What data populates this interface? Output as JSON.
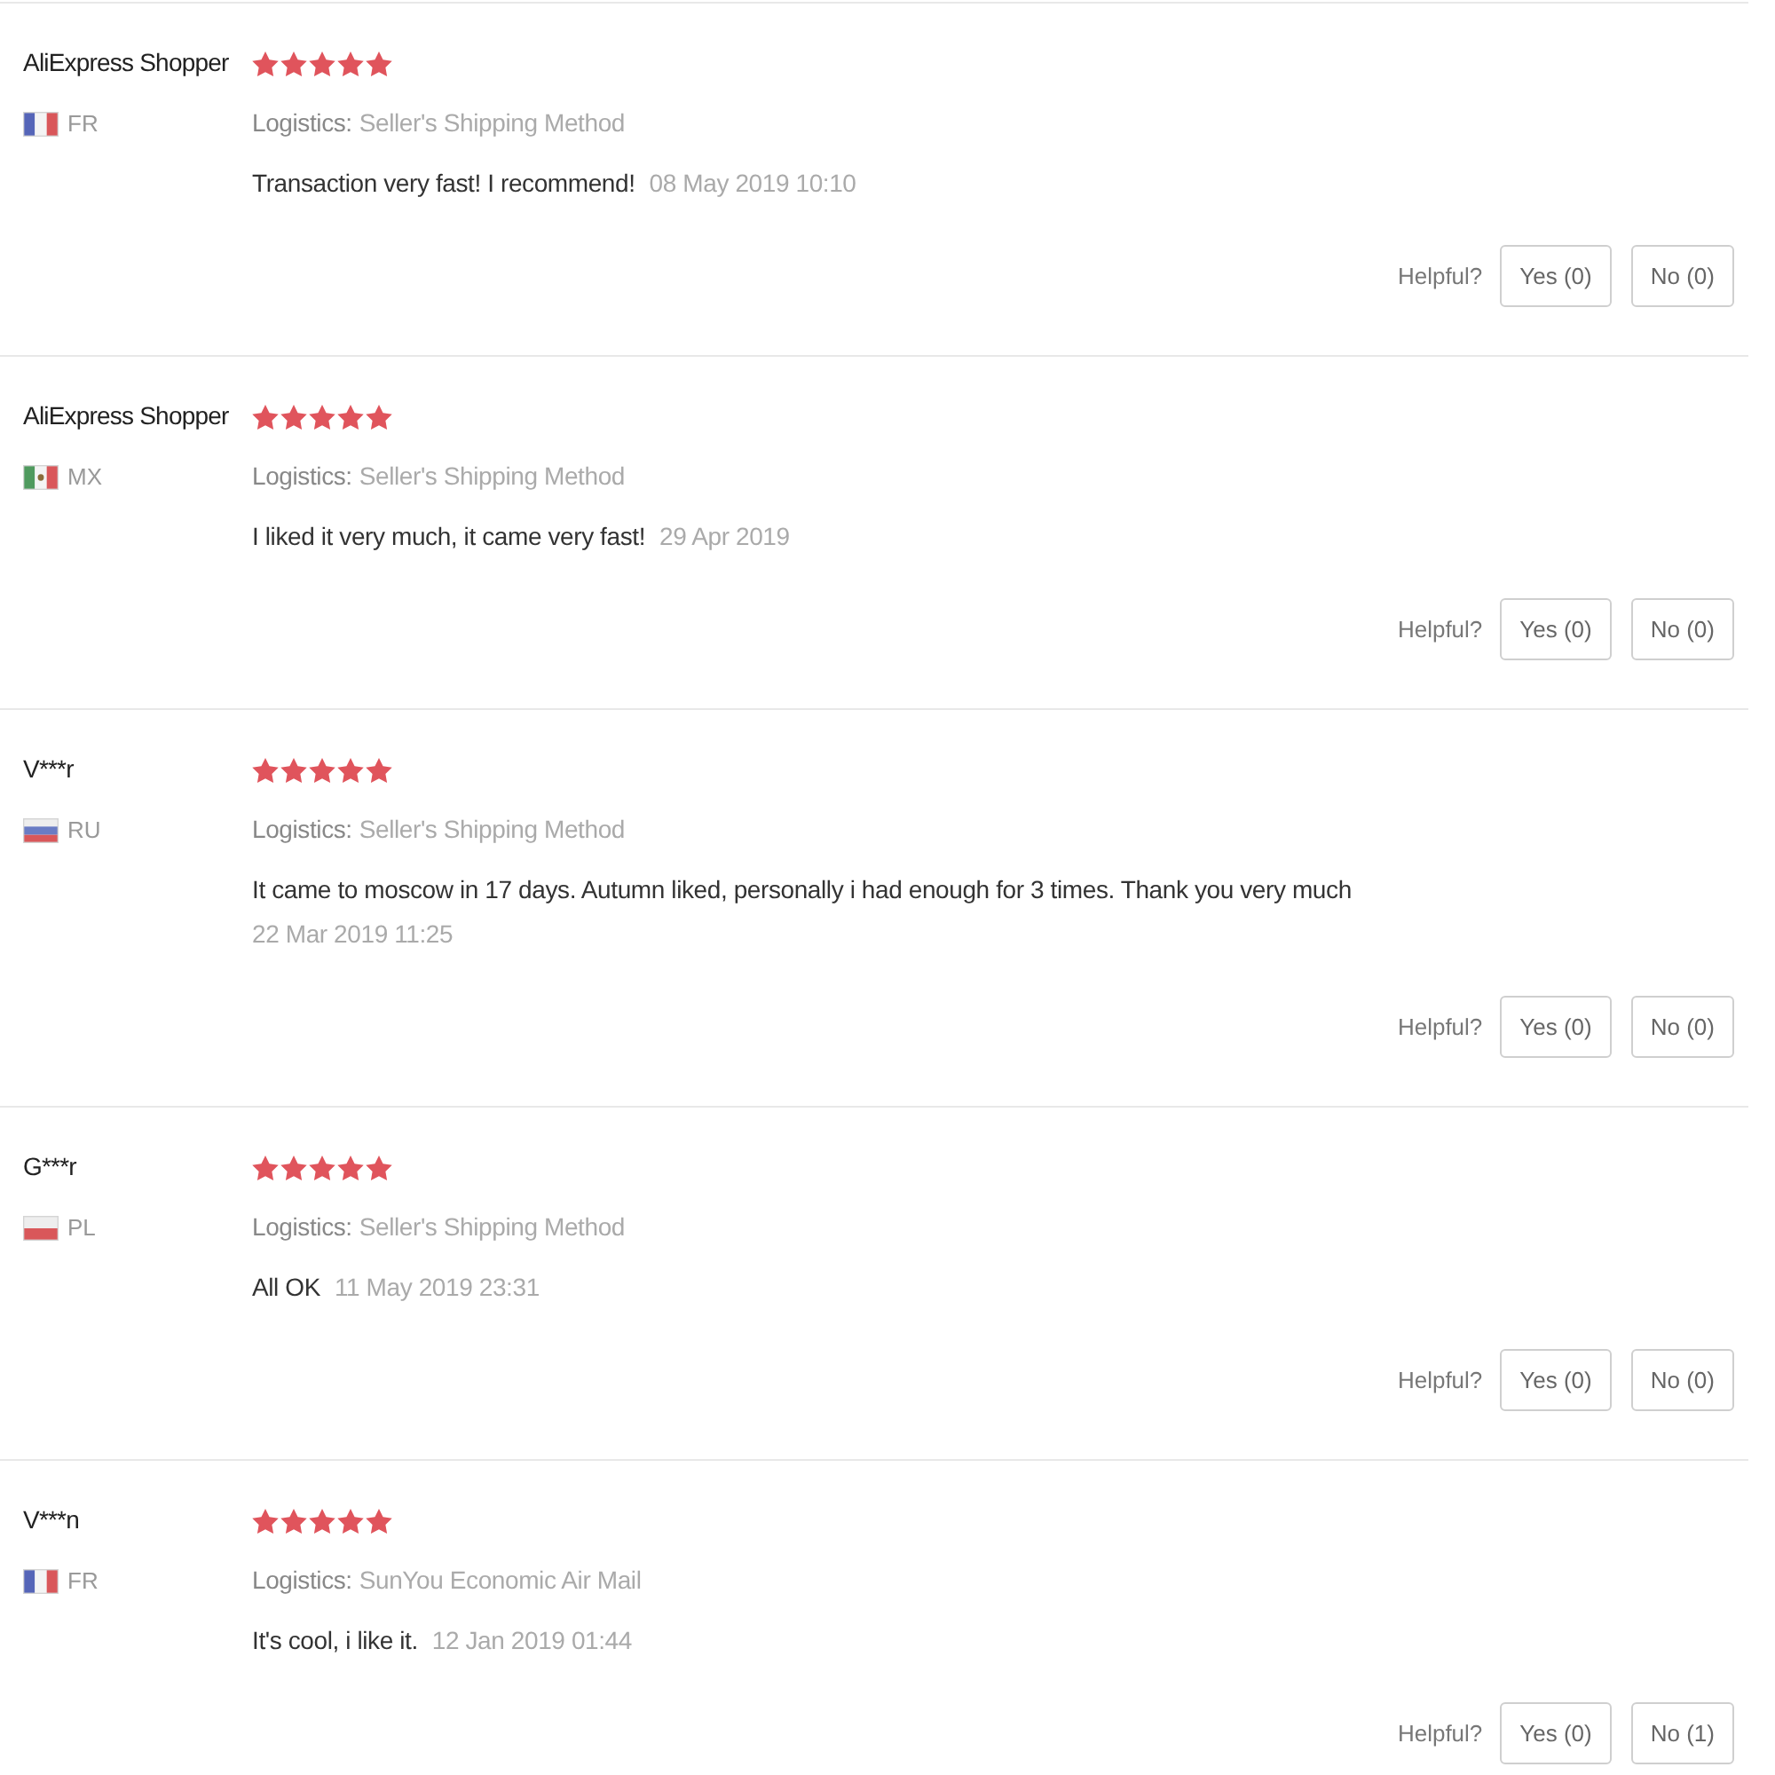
{
  "reviews": [
    {
      "name": "AliExpress Shopper",
      "stars": 5,
      "country": {
        "code": "FR",
        "flag": {
          "kind": "vertical",
          "stripes": [
            {
              "color": "#5565b8"
            },
            {
              "color": "#f4f4f4"
            },
            {
              "color": "#d9575a"
            }
          ]
        }
      },
      "logistics_label": "Logistics:",
      "logistics": "Seller's Shipping Method",
      "comment": "Transaction very fast! I recommend!",
      "date": "08 May 2019 10:10",
      "helpful_label": "Helpful?",
      "yes_button": "Yes (0)",
      "no_button": "No (0)"
    },
    {
      "name": "AliExpress Shopper",
      "stars": 5,
      "country": {
        "code": "MX",
        "flag": {
          "kind": "vertical_emblem",
          "stripes": [
            {
              "color": "#4f9a5e"
            },
            {
              "color": "#f4f4f4"
            },
            {
              "color": "#d9575a"
            }
          ]
        }
      },
      "logistics_label": "Logistics:",
      "logistics": "Seller's Shipping Method",
      "comment": "I liked it very much, it came very fast!",
      "date": "29 Apr 2019",
      "helpful_label": "Helpful?",
      "yes_button": "Yes (0)",
      "no_button": "No (0)"
    },
    {
      "name": "V***r",
      "stars": 5,
      "country": {
        "code": "RU",
        "flag": {
          "kind": "horizontal",
          "stripes": [
            {
              "color": "#eeeeee"
            },
            {
              "color": "#6a7cc4"
            },
            {
              "color": "#d9575a"
            }
          ]
        }
      },
      "logistics_label": "Logistics:",
      "logistics": "Seller's Shipping Method",
      "comment": "It came to moscow in 17 days. Autumn liked, personally i had enough for 3 times. Thank you very much",
      "date": "22 Mar 2019 11:25",
      "helpful_label": "Helpful?",
      "yes_button": "Yes (0)",
      "no_button": "No (0)"
    },
    {
      "name": "G***r",
      "stars": 5,
      "country": {
        "code": "PL",
        "flag": {
          "kind": "horizontal",
          "stripes": [
            {
              "color": "#eeeeee"
            },
            {
              "color": "#d9575a"
            }
          ]
        }
      },
      "logistics_label": "Logistics:",
      "logistics": "Seller's Shipping Method",
      "comment": "All OK",
      "date": "11 May 2019 23:31",
      "helpful_label": "Helpful?",
      "yes_button": "Yes (0)",
      "no_button": "No (0)"
    },
    {
      "name": "V***n",
      "stars": 5,
      "country": {
        "code": "FR",
        "flag": {
          "kind": "vertical",
          "stripes": [
            {
              "color": "#5565b8"
            },
            {
              "color": "#f4f4f4"
            },
            {
              "color": "#d9575a"
            }
          ]
        }
      },
      "logistics_label": "Logistics:",
      "logistics": "SunYou Economic Air Mail",
      "comment": "It's cool, i like it.",
      "date": "12 Jan 2019 01:44",
      "helpful_label": "Helpful?",
      "yes_button": "Yes (0)",
      "no_button": "No (1)"
    }
  ]
}
